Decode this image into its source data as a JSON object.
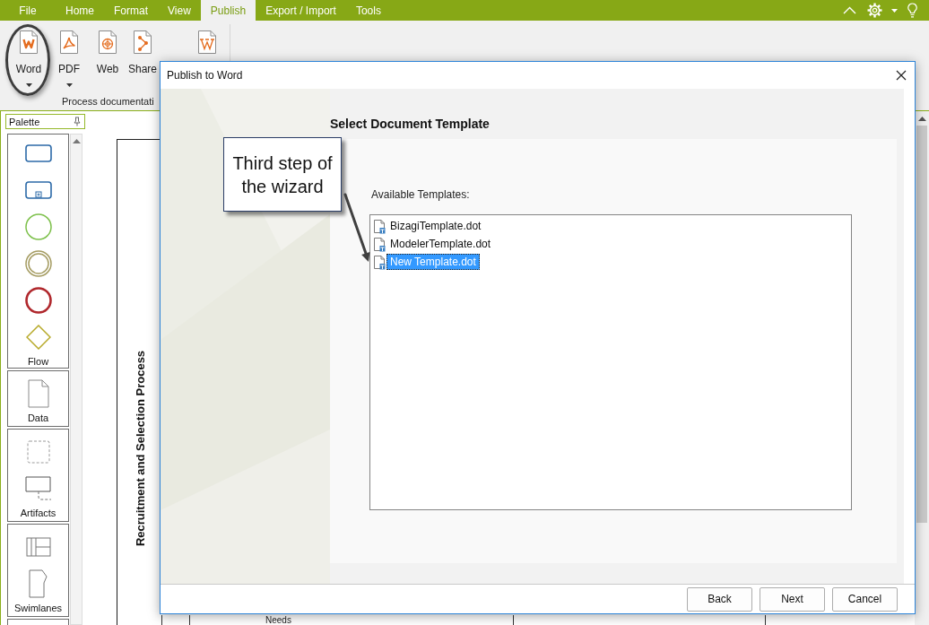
{
  "menu_bar": {
    "tabs": [
      {
        "label": "File",
        "selected": false
      },
      {
        "label": "Home",
        "selected": false
      },
      {
        "label": "Format",
        "selected": false
      },
      {
        "label": "View",
        "selected": false
      },
      {
        "label": "Publish",
        "selected": true
      },
      {
        "label": "Export / Import",
        "selected": false
      },
      {
        "label": "Tools",
        "selected": false
      }
    ]
  },
  "ribbon": {
    "buttons": [
      {
        "kind": "word",
        "label": "Word",
        "dropdown": true,
        "highlighted": true
      },
      {
        "kind": "pdf",
        "label": "PDF",
        "dropdown": true,
        "highlighted": false
      },
      {
        "kind": "web",
        "label": "Web",
        "dropdown": false,
        "highlighted": false
      },
      {
        "kind": "share",
        "label": "Share",
        "dropdown": false,
        "highlighted": false
      },
      {
        "kind": "wiki",
        "dropdown": false,
        "highlighted": false
      }
    ],
    "group_label": "Process documentati"
  },
  "palette": {
    "title": "Palette",
    "sections": [
      {
        "label": "Flow",
        "shapes": [
          {
            "kind": "task"
          },
          {
            "kind": "subprocess"
          },
          {
            "kind": "start-event"
          },
          {
            "kind": "intermediate-event"
          },
          {
            "kind": "end-event"
          },
          {
            "kind": "gateway"
          }
        ]
      },
      {
        "label": "Data",
        "shapes": [
          {
            "kind": "data-object"
          }
        ]
      },
      {
        "label": "Artifacts",
        "shapes": [
          {
            "kind": "group"
          },
          {
            "kind": "annotation"
          }
        ]
      },
      {
        "label": "Swimlanes",
        "shapes": [
          {
            "kind": "lanes"
          },
          {
            "kind": "phase"
          }
        ]
      }
    ]
  },
  "canvas": {
    "pool_title": "Recruitment and Selection Process",
    "lane_text": "Needs"
  },
  "dialog": {
    "title": "Publish to Word",
    "heading": "Select Document Template",
    "list_label": "Available Templates:",
    "templates": [
      {
        "name": "BizagiTemplate.dot",
        "selected": false
      },
      {
        "name": "ModelerTemplate.dot",
        "selected": false
      },
      {
        "name": "New Template.dot",
        "selected": true
      }
    ],
    "buttons": [
      {
        "label": "Back"
      },
      {
        "label": "Next"
      },
      {
        "label": "Cancel"
      }
    ]
  },
  "callout": {
    "text": "Third step of the wizard"
  }
}
